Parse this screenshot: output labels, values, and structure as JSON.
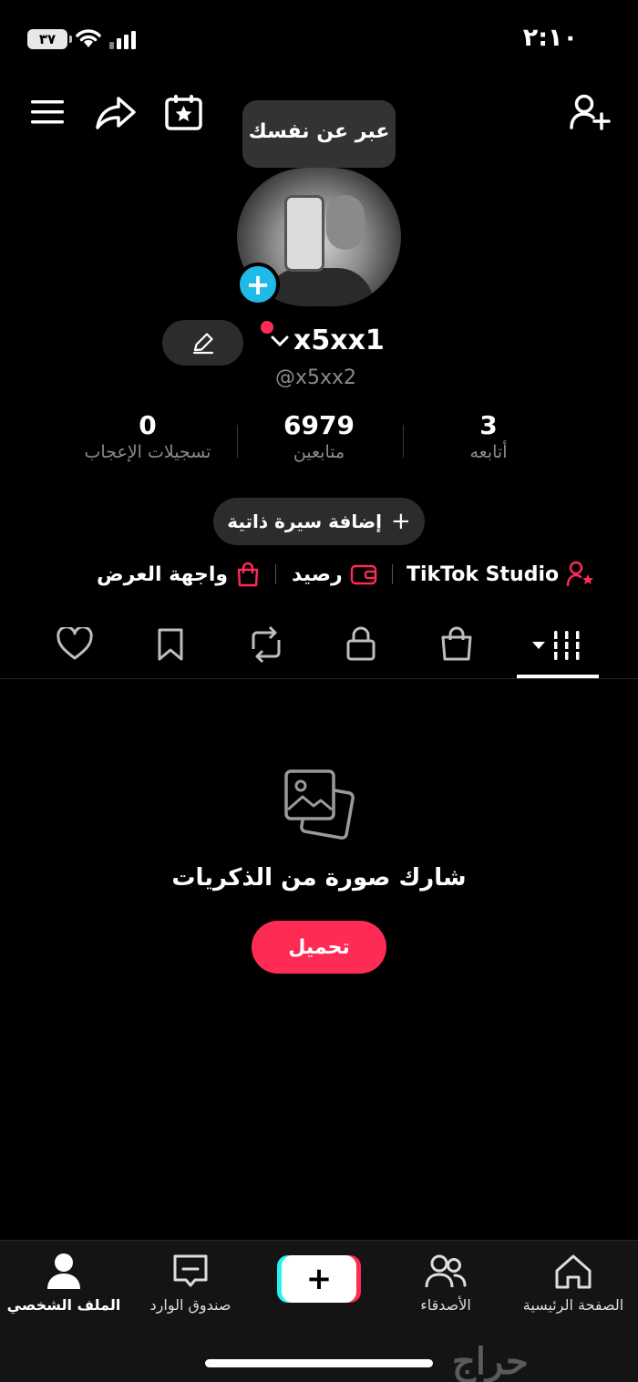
{
  "status_bar": {
    "time": "٢:١٠",
    "battery": "٣٧"
  },
  "header": {
    "tooltip": "عبر عن نفسك"
  },
  "profile": {
    "username": "x5xx1",
    "handle": "@x5xx2"
  },
  "stats": {
    "following": {
      "value": "3",
      "label": "أتابعه"
    },
    "followers": {
      "value": "6979",
      "label": "متابعين"
    },
    "likes": {
      "value": "0",
      "label": "تسجيلات الإعجاب"
    }
  },
  "bio_button": "إضافة سيرة ذاتية",
  "links": {
    "studio": "TikTok Studio",
    "balance": "رصيد",
    "showcase": "واجهة العرض"
  },
  "tabs": [
    "videos-grid-icon",
    "shop-bag-icon",
    "lock-icon",
    "repost-icon",
    "bookmark-icon",
    "heart-icon"
  ],
  "empty_state": {
    "title": "شارك صورة من الذكريات",
    "button": "تحميل"
  },
  "bottom_nav": {
    "home": "الصفحة الرئيسية",
    "friends": "الأصدقاء",
    "inbox": "صندوق الوارد",
    "profile": "الملف الشخصي"
  },
  "watermark": "حراج",
  "colors": {
    "accent": "#fe2c55",
    "cyan": "#25f4ee",
    "badge": "#1fbbe8"
  }
}
